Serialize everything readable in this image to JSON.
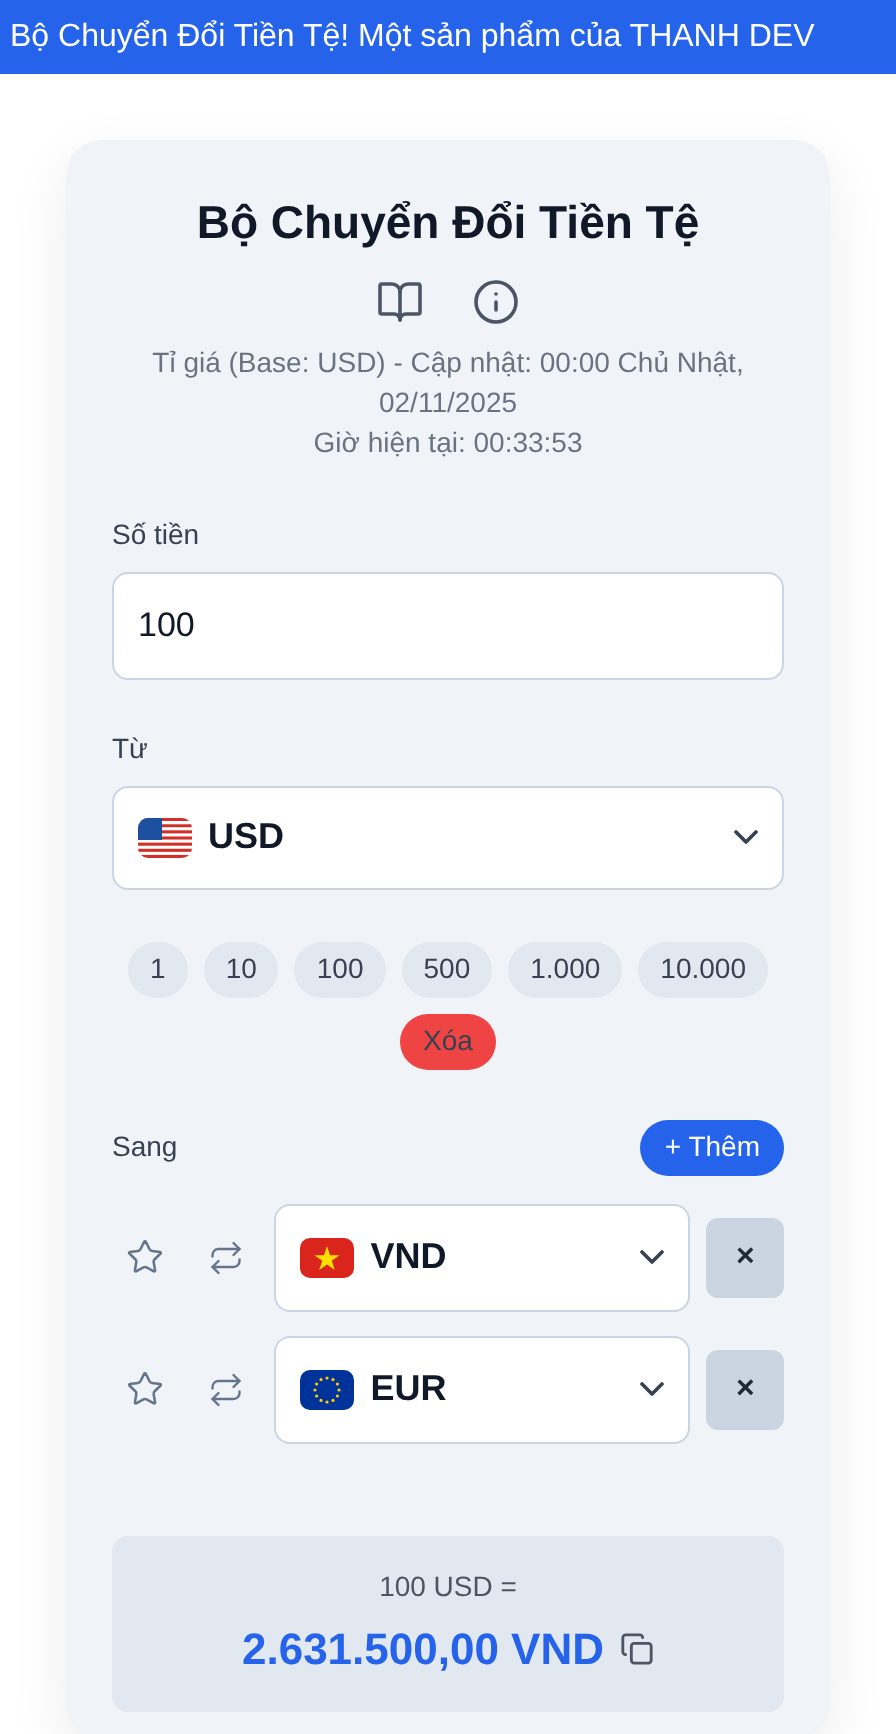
{
  "banner": {
    "text": "Bộ Chuyển Đổi Tiền Tệ! Một sản phẩm của THANH DEV"
  },
  "title": "Bộ Chuyển Đổi Tiền Tệ",
  "rate_info": "Tỉ giá (Base: USD) - Cập nhật: 00:00 Chủ Nhật, 02/11/2025",
  "current_time": "Giờ hiện tại: 00:33:53",
  "amount": {
    "label": "Số tiền",
    "value": "100"
  },
  "from": {
    "label": "Từ",
    "currency": "USD",
    "kind": "us"
  },
  "quick_amounts": [
    "1",
    "10",
    "100",
    "500",
    "1.000",
    "10.000"
  ],
  "clear_button": "Xóa",
  "to": {
    "label": "Sang",
    "add_button": "+ Thêm",
    "targets": [
      {
        "currency": "VND",
        "kind": "vn",
        "favorite": false,
        "remove": "×"
      },
      {
        "currency": "EUR",
        "kind": "eu",
        "favorite": false,
        "remove": "×"
      }
    ]
  },
  "result": {
    "source": "100 USD =",
    "value": "2.631.500,00 VND"
  }
}
